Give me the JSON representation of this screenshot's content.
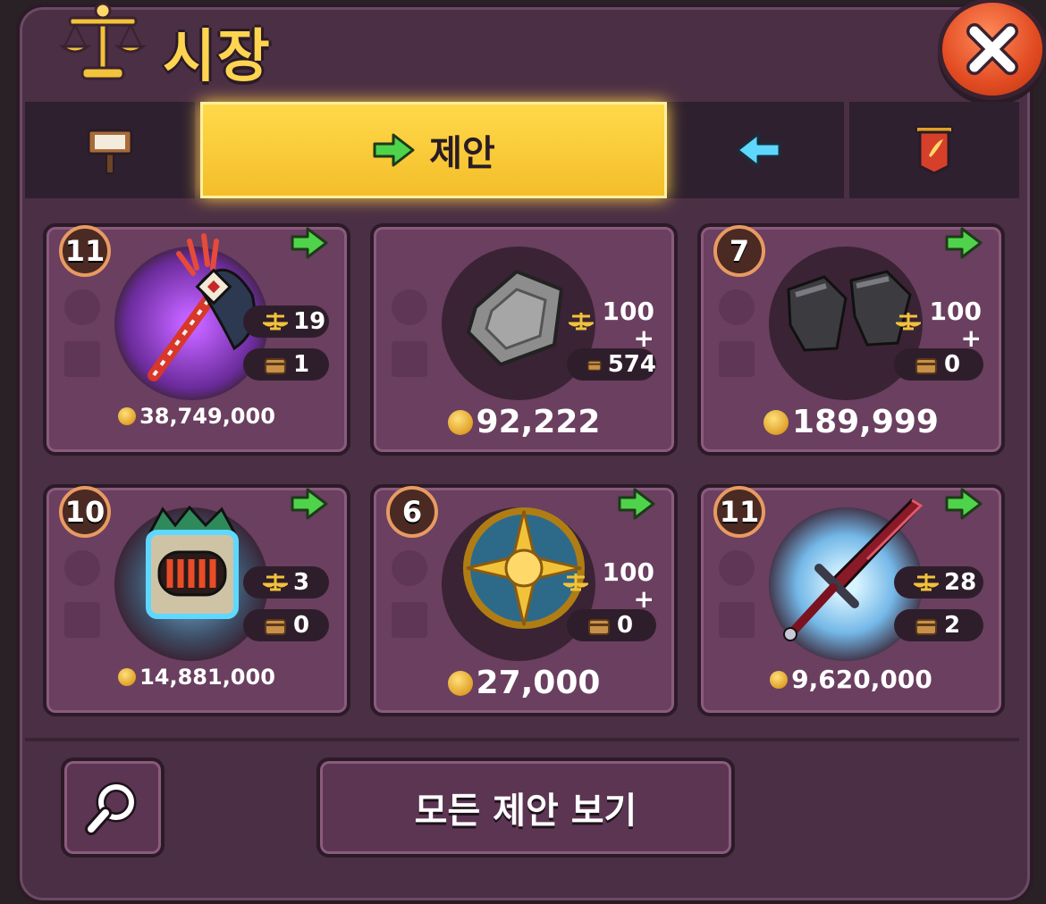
{
  "header": {
    "title": "시장"
  },
  "tabs": [
    {
      "name": "sign",
      "icon": "signpost-icon"
    },
    {
      "name": "offers",
      "label": "제안",
      "icon": "green-arrow-right-icon",
      "active": true
    },
    {
      "name": "incoming",
      "icon": "cyan-arrow-left-icon"
    },
    {
      "name": "history",
      "icon": "red-banner-icon"
    }
  ],
  "cards": [
    {
      "level": "11",
      "item": "purple-axe",
      "scales": "19",
      "chests": "1",
      "price": "38,749,000"
    },
    {
      "level": "",
      "item": "stone-block",
      "scales_top": "100",
      "scales_plus": "+",
      "chests": "574",
      "price": "92,222"
    },
    {
      "level": "7",
      "item": "iron-gauntlets",
      "scales_top": "100",
      "scales_plus": "+",
      "chests": "0",
      "price": "189,999"
    },
    {
      "level": "10",
      "item": "chest-armor",
      "scales": "3",
      "chests": "0",
      "price": "14,881,000"
    },
    {
      "level": "6",
      "item": "golden-shield",
      "scales_top": "100",
      "scales_plus": "+",
      "chests": "0",
      "price": "27,000"
    },
    {
      "level": "11",
      "item": "crimson-sword",
      "scales": "28",
      "chests": "2",
      "price": "9,620,000"
    }
  ],
  "footer": {
    "view_all": "모든 제안 보기"
  },
  "colors": {
    "panel": "#4b2f45",
    "card": "#6a3f5f",
    "active_tab": "#f4be2a",
    "gold_text": "#ffd451",
    "close": "#e24b22"
  }
}
